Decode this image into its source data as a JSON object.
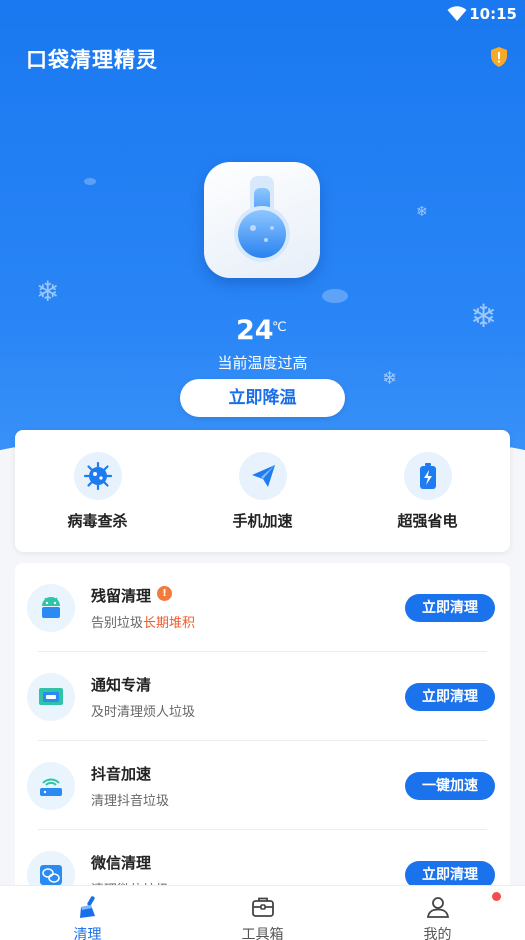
{
  "status_bar": {
    "time": "10:15"
  },
  "header": {
    "title": "口袋清理精灵"
  },
  "hero": {
    "temperature": "24",
    "unit": "℃",
    "status": "当前温度过高",
    "cool_button_label": "立即降温"
  },
  "features": [
    {
      "label": "病毒查杀",
      "icon": "virus-icon"
    },
    {
      "label": "手机加速",
      "icon": "rocket-plane-icon"
    },
    {
      "label": "超强省电",
      "icon": "battery-icon"
    }
  ],
  "list": [
    {
      "title": "残留清理",
      "desc_prefix": "告别垃圾",
      "desc_highlight": "长期堆积",
      "badge": "!",
      "button": "立即清理",
      "icon": "android-icon"
    },
    {
      "title": "通知专清",
      "desc_prefix": "及时清理烦人垃圾",
      "desc_highlight": "",
      "button": "立即清理",
      "icon": "notification-icon"
    },
    {
      "title": "抖音加速",
      "desc_prefix": "清理抖音垃圾",
      "desc_highlight": "",
      "button": "一键加速",
      "icon": "signal-icon"
    },
    {
      "title": "微信清理",
      "desc_prefix": "清理微信垃圾",
      "desc_highlight": "",
      "button": "立即清理",
      "icon": "wechat-icon"
    }
  ],
  "nav": [
    {
      "label": "清理",
      "active": true,
      "icon": "broom-icon"
    },
    {
      "label": "工具箱",
      "active": false,
      "icon": "toolbox-icon"
    },
    {
      "label": "我的",
      "active": false,
      "icon": "user-icon"
    }
  ],
  "colors": {
    "primary": "#1a72ec",
    "hero": "#2a86f6",
    "highlight": "#f25a2b",
    "badge": "#f47a3b",
    "notify_dot": "#f44b4b"
  }
}
